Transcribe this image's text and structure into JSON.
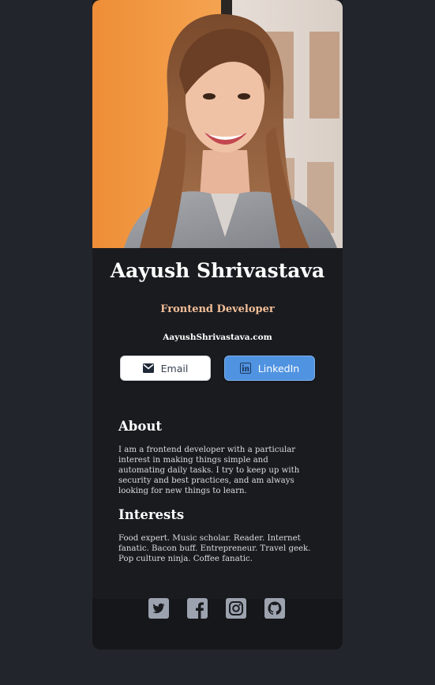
{
  "profile": {
    "photo_alt": "Aayush Shrivastava",
    "name": "Aayush Shrivastava",
    "role": "Frontend Developer",
    "website": "AayushShrivastava.com"
  },
  "buttons": {
    "email_label": "Email",
    "linkedin_label": "LinkedIn"
  },
  "about": {
    "heading": "About",
    "text": "I am a frontend developer with a particular interest in making things simple and automating daily tasks. I try to keep up with security and best practices, and am always looking for new things to learn."
  },
  "interests": {
    "heading": "Interests",
    "text": "Food expert. Music scholar. Reader. Internet fanatic. Bacon buff. Entrepreneur. Travel geek. Pop culture ninja. Coffee fanatic."
  },
  "social": [
    "twitter-icon",
    "facebook-icon",
    "instagram-icon",
    "github-icon"
  ],
  "colors": {
    "page_bg": "#23252c",
    "card_bg": "#1a1b1f",
    "footer_bg": "#16171a",
    "accent": "#f3bf99",
    "linkedin": "#5093e1",
    "icon": "#9ca3af"
  }
}
